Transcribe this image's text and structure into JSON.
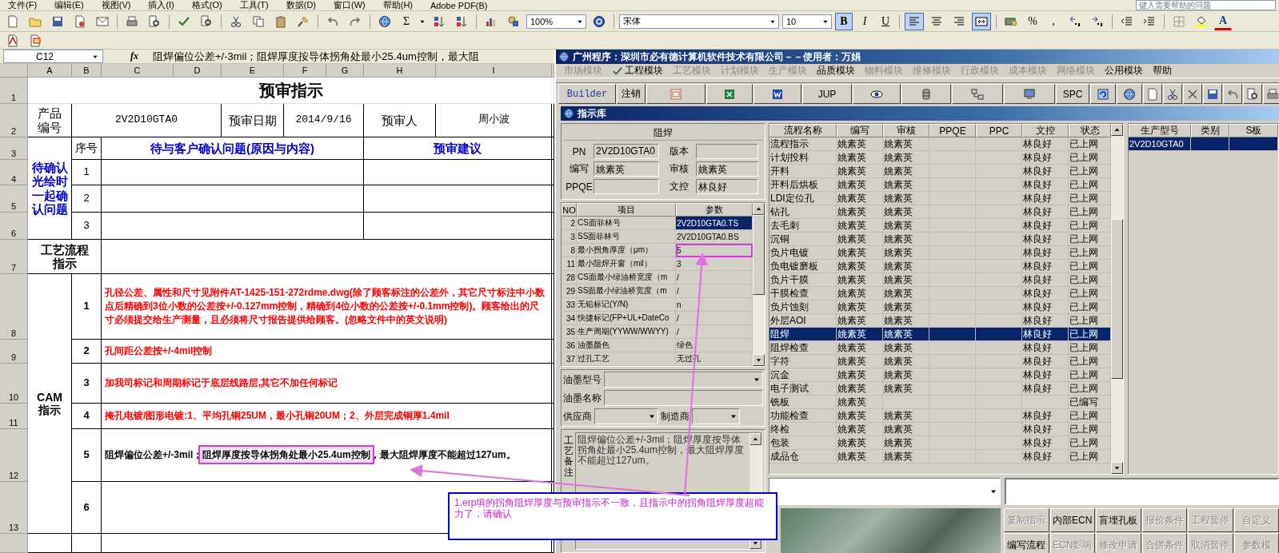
{
  "excel": {
    "menu": [
      "文件(F)",
      "编辑(E)",
      "视图(V)",
      "插入(I)",
      "格式(O)",
      "工具(T)",
      "数据(D)",
      "窗口(W)",
      "帮助(H)",
      "Adobe PDF(B)"
    ],
    "help_search": {
      "placeholder": "键入需要帮助的问题"
    },
    "toolbar": {
      "sum_glyph": "Σ",
      "zoom": "100%",
      "font": "宋体",
      "font_size": "10",
      "font_color_glyph": "A",
      "number_glyphs": [
        "%",
        ","
      ],
      "formatting": [
        {
          "label": "B",
          "kind": "bold",
          "on": true
        },
        {
          "label": "I",
          "kind": "italic",
          "on": false
        },
        {
          "label": "U",
          "kind": "underline",
          "on": false
        }
      ],
      "alignment": [
        {
          "kind": "left",
          "on": true
        },
        {
          "kind": "center",
          "on": false
        },
        {
          "kind": "right",
          "on": false
        },
        {
          "kind": "merge",
          "on": true
        }
      ]
    },
    "name_box": "C12",
    "function_label": "fx",
    "formula": "阻焊偏位公差+/-3mil；阻焊厚度按导体拐角处最小25.4um控制，最大阻",
    "columns": [
      "A",
      "B",
      "C",
      "D",
      "E",
      "F",
      "G",
      "H",
      "I"
    ],
    "row_numbers": [
      "1",
      "2",
      "3",
      "4",
      "5",
      "6",
      "7",
      "8",
      "9",
      "10",
      "11",
      "12",
      "13"
    ],
    "sheet": {
      "title": "预审指示",
      "header": [
        {
          "label": "产品编号"
        },
        {
          "value": "2V2D10GTA0"
        },
        {
          "label": "预审日期"
        },
        {
          "value": "2014/9/16"
        },
        {
          "label": "预审人"
        },
        {
          "value": "周小波"
        }
      ],
      "confirm": {
        "group_label": "待确认光绘时一起确认问题",
        "seq_header": "序号",
        "question_header": "待与客户确认问题(原因与内容)",
        "advice_header": "预审建议",
        "rows": [
          "1",
          "2",
          "3"
        ]
      },
      "process_label": "工艺流程指示",
      "cam": {
        "label": "CAM指示",
        "items": [
          {
            "no": "1",
            "color": "#ff0000",
            "parts": [
              {
                "text": "孔径公差、属性和尺寸见附件AT-1425-151-272rdme.dwg(除了顾客标注的公差外，其它尺寸标注中小数点后精确到3位小数的公差按+/-0.127mm控制，精确到4位小数的公差按+/-0.1mm控制)。顾客给出的尺寸必须提交给生产测量，且必须将尺寸报告提供给顾客。(忽略文件中的英文说明)",
                "highlighted": false
              }
            ]
          },
          {
            "no": "2",
            "color": "#ff0000",
            "parts": [
              {
                "text": "孔间距公差按+/-4mil控制",
                "highlighted": false
              }
            ]
          },
          {
            "no": "3",
            "color": "#ff0000",
            "parts": [
              {
                "text": "加我司标记和周期标记于底层线路层,其它不加任何标记",
                "highlighted": false
              }
            ]
          },
          {
            "no": "4",
            "color": "#ff0000",
            "parts": [
              {
                "text": "掩孔电镀/图形电镀:1、平均孔铜25UM，最小孔铜20UM；2、外层完成铜厚1.4mil",
                "highlighted": false
              }
            ]
          },
          {
            "no": "5",
            "color": "#000000",
            "parts": [
              {
                "text": "阻焊偏位公差+/-3mil；",
                "highlighted": false
              },
              {
                "text": "阻焊厚度按导体拐角处最小25.4um控制",
                "highlighted": true
              },
              {
                "text": "，最大阻焊厚度不能超过127um。",
                "highlighted": false
              }
            ]
          },
          {
            "no": "6"
          }
        ]
      }
    }
  },
  "erp": {
    "title": "广州程序：深圳市必有德计算机软件技术有限公司－－使用者：万娟",
    "modules": [
      {
        "label": "市场模块",
        "disabled": true,
        "checked": false
      },
      {
        "label": "工程模块",
        "disabled": false,
        "checked": true
      },
      {
        "label": "工艺模块",
        "disabled": true,
        "checked": false
      },
      {
        "label": "计划模块",
        "disabled": true,
        "checked": false
      },
      {
        "label": "生产模块",
        "disabled": true,
        "checked": false
      },
      {
        "label": "品质模块",
        "disabled": false,
        "checked": false
      },
      {
        "label": "物料模块",
        "disabled": true,
        "checked": false
      },
      {
        "label": "维修模块",
        "disabled": true,
        "checked": false
      },
      {
        "label": "行政模块",
        "disabled": true,
        "checked": false
      },
      {
        "label": "成本模块",
        "disabled": true,
        "checked": false
      },
      {
        "label": "网络模块",
        "disabled": true,
        "checked": false
      },
      {
        "label": "公用模块",
        "disabled": false,
        "checked": false
      },
      {
        "label": "帮助",
        "disabled": false,
        "checked": false
      }
    ],
    "toolbar": [
      "Builder",
      "注销",
      "JUP",
      "SPC"
    ],
    "library": {
      "title": "指示库",
      "group": "阻焊",
      "fields": [
        {
          "label": "PN",
          "value": "2V2D10GTA0"
        },
        {
          "label": "版本"
        },
        {
          "label": "编写",
          "value": "姚素英"
        },
        {
          "label": "审核",
          "value": "姚素英"
        },
        {
          "label": "PPQE"
        },
        {
          "label": "文控",
          "value": "林良好"
        }
      ],
      "params": {
        "columns": [
          "NO",
          "项目",
          "参数"
        ],
        "rows": [
          {
            "no": "2",
            "item": "CS面菲林号",
            "value": "2V2D10GTA0.TS",
            "selected": true,
            "highlighted": false
          },
          {
            "no": "3",
            "item": "SS面菲林号",
            "value": "2V2D10GTA0.BS",
            "selected": false,
            "highlighted": false
          },
          {
            "no": "8",
            "item": "最小拐角厚度（μm）",
            "value": "5",
            "selected": false,
            "highlighted": true
          },
          {
            "no": "11",
            "item": "最小阻焊开窗（mil）",
            "value": "3",
            "selected": false,
            "highlighted": false
          },
          {
            "no": "28",
            "item": "CS面最小绿油桥宽度（m",
            "value": "/",
            "selected": false,
            "highlighted": false
          },
          {
            "no": "29",
            "item": "SS面最小绿油桥宽度（m",
            "value": "/",
            "selected": false,
            "highlighted": false
          },
          {
            "no": "33",
            "item": "无铅标记(Y/N)",
            "value": "n",
            "selected": false,
            "highlighted": false
          },
          {
            "no": "34",
            "item": "快捷标记(FP+UL+DateCo",
            "value": "/",
            "selected": false,
            "highlighted": false
          },
          {
            "no": "35",
            "item": "生产周期(YYWW/WWYY)",
            "value": "/",
            "selected": false,
            "highlighted": false
          },
          {
            "no": "36",
            "item": "油墨颜色",
            "value": "绿色",
            "selected": false,
            "highlighted": false
          },
          {
            "no": "37",
            "item": "过孔工艺",
            "value": "无过孔",
            "selected": false,
            "highlighted": false
          }
        ]
      },
      "ink": [
        {
          "label": "油墨型号",
          "kind": "select"
        },
        {
          "label": "油墨名称",
          "kind": "text"
        }
      ],
      "makers": [
        {
          "label": "供应商"
        },
        {
          "label": "制造商"
        }
      ],
      "remark": {
        "label": "工艺备注",
        "text": "阻焊偏位公差+/-3mil；阻焊厚度按导体拐角处最小25.4um控制，最大阻焊厚度不能超过127um。"
      }
    },
    "process": {
      "columns": [
        "流程名称",
        "编写",
        "审核",
        "PPQE",
        "PPC",
        "文控",
        "状态"
      ],
      "rows": [
        {
          "name": "流程指示",
          "writer": "姚素英",
          "reviewer": "姚素英",
          "doc_control": "林良好",
          "status": "已上网",
          "selected": false
        },
        {
          "name": "计划投料",
          "writer": "姚素英",
          "reviewer": "姚素英",
          "doc_control": "林良好",
          "status": "已上网",
          "selected": false
        },
        {
          "name": "开料",
          "writer": "姚素英",
          "reviewer": "姚素英",
          "doc_control": "林良好",
          "status": "已上网",
          "selected": false
        },
        {
          "name": "开料后烘板",
          "writer": "姚素英",
          "reviewer": "姚素英",
          "doc_control": "林良好",
          "status": "已上网",
          "selected": false
        },
        {
          "name": "LDI定位孔",
          "writer": "姚素英",
          "reviewer": "姚素英",
          "doc_control": "林良好",
          "status": "已上网",
          "selected": false
        },
        {
          "name": "钻孔",
          "writer": "姚素英",
          "reviewer": "姚素英",
          "doc_control": "林良好",
          "status": "已上网",
          "selected": false
        },
        {
          "name": "去毛刺",
          "writer": "姚素英",
          "reviewer": "姚素英",
          "doc_control": "林良好",
          "status": "已上网",
          "selected": false
        },
        {
          "name": "沉铜",
          "writer": "姚素英",
          "reviewer": "姚素英",
          "doc_control": "林良好",
          "status": "已上网",
          "selected": false
        },
        {
          "name": "负片电镀",
          "writer": "姚素英",
          "reviewer": "姚素英",
          "doc_control": "林良好",
          "status": "已上网",
          "selected": false
        },
        {
          "name": "负电镀磨板",
          "writer": "姚素英",
          "reviewer": "姚素英",
          "doc_control": "林良好",
          "status": "已上网",
          "selected": false
        },
        {
          "name": "负片干膜",
          "writer": "姚素英",
          "reviewer": "姚素英",
          "doc_control": "林良好",
          "status": "已上网",
          "selected": false
        },
        {
          "name": "干膜检查",
          "writer": "姚素英",
          "reviewer": "姚素英",
          "doc_control": "林良好",
          "status": "已上网",
          "selected": false
        },
        {
          "name": "负片蚀刻",
          "writer": "姚素英",
          "reviewer": "姚素英",
          "doc_control": "林良好",
          "status": "已上网",
          "selected": false
        },
        {
          "name": "外层AOI",
          "writer": "姚素英",
          "reviewer": "姚素英",
          "doc_control": "林良好",
          "status": "已上网",
          "selected": false
        },
        {
          "name": "阻焊",
          "writer": "姚素英",
          "reviewer": "姚素英",
          "doc_control": "林良好",
          "status": "已上网",
          "selected": true
        },
        {
          "name": "阻焊检查",
          "writer": "姚素英",
          "reviewer": "姚素英",
          "doc_control": "林良好",
          "status": "已上网",
          "selected": false
        },
        {
          "name": "字符",
          "writer": "姚素英",
          "reviewer": "姚素英",
          "doc_control": "林良好",
          "status": "已上网",
          "selected": false
        },
        {
          "name": "沉金",
          "writer": "姚素英",
          "reviewer": "姚素英",
          "doc_control": "林良好",
          "status": "已上网",
          "selected": false
        },
        {
          "name": "电子测试",
          "writer": "姚素英",
          "reviewer": "姚素英",
          "doc_control": "林良好",
          "status": "已上网",
          "selected": false
        },
        {
          "name": "铣板",
          "writer": "姚素英",
          "status": "已编写",
          "selected": false
        },
        {
          "name": "功能检查",
          "writer": "姚素英",
          "reviewer": "姚素英",
          "doc_control": "林良好",
          "status": "已上网",
          "selected": false
        },
        {
          "name": "终检",
          "writer": "姚素英",
          "reviewer": "姚素英",
          "doc_control": "林良好",
          "status": "已上网",
          "selected": false
        },
        {
          "name": "包装",
          "writer": "姚素英",
          "reviewer": "姚素英",
          "doc_control": "林良好",
          "status": "已上网",
          "selected": false
        },
        {
          "name": "成品仓",
          "writer": "姚素英",
          "reviewer": "姚素英",
          "doc_control": "林良好",
          "status": "已上网",
          "selected": false
        }
      ]
    },
    "models": {
      "columns": [
        "生产型号",
        "类别",
        "S板"
      ],
      "rows": [
        {
          "model": "2V2D10GTA0",
          "selected": true
        }
      ]
    },
    "buttons": [
      [
        {
          "label": "复制指示",
          "disabled": true
        },
        {
          "label": "内部ECN",
          "disabled": false
        },
        {
          "label": "盲埋孔板",
          "disabled": false
        },
        {
          "label": "报价条件",
          "disabled": true
        },
        {
          "label": "工程暂停",
          "disabled": true
        },
        {
          "label": "自定义",
          "disabled": true
        }
      ],
      [
        {
          "label": "编写流程",
          "disabled": false
        },
        {
          "label": "ECN影响",
          "disabled": true
        },
        {
          "label": "修改申请",
          "disabled": true
        },
        {
          "label": "合拼条件",
          "disabled": true
        },
        {
          "label": "取消暂停",
          "disabled": true
        },
        {
          "label": "参数模",
          "disabled": true
        }
      ]
    ]
  },
  "annotation": {
    "text": "1.erp填的拐角阻焊厚度与预审指示不一致，且指示中的拐角阻焊厚度超能力了，请确认"
  }
}
